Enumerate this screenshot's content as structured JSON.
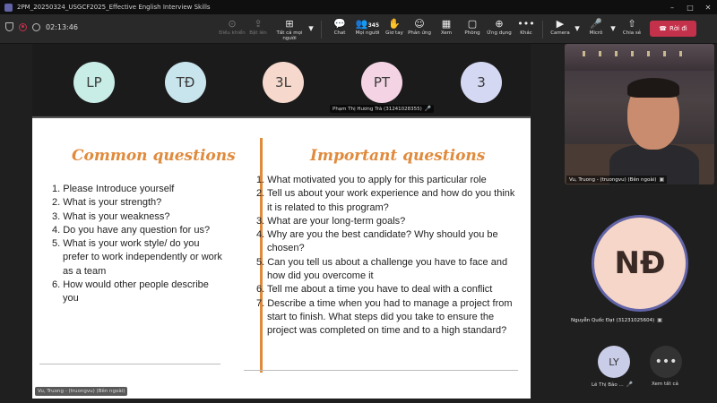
{
  "window": {
    "title": "2PM_20250324_USGCF2025_Effective English Interview Skills",
    "minimize": "–",
    "maximize": "□",
    "close": "✕"
  },
  "toolbar": {
    "timer": "02:13:46",
    "items": [
      {
        "label": "Điều khiển",
        "icon": "⊙"
      },
      {
        "label": "Bật lên",
        "icon": "⇪"
      },
      {
        "label": "Tất cả mọi người",
        "icon": "⊞"
      },
      {
        "label": "Chat",
        "icon": "💬"
      },
      {
        "label": "Mọi người",
        "icon": "👥",
        "count": "345"
      },
      {
        "label": "Giơ tay",
        "icon": "✋"
      },
      {
        "label": "Phản ứng",
        "icon": "☺"
      },
      {
        "label": "Xem",
        "icon": "▦"
      },
      {
        "label": "Phòng",
        "icon": "▢"
      },
      {
        "label": "Ứng dụng",
        "icon": "⊕"
      },
      {
        "label": "Khác",
        "icon": "•••"
      },
      {
        "label": "Camera",
        "icon": "▶"
      },
      {
        "label": "Micrô",
        "icon": "🎤"
      },
      {
        "label": "Chia sẻ",
        "icon": "⇧"
      }
    ],
    "leave_label": "Rời đi",
    "dropdown_arrow": "▾"
  },
  "strip": {
    "avatars": [
      {
        "initials": "LP",
        "color": "#c8ece6"
      },
      {
        "initials": "TĐ",
        "color": "#c8e4ec"
      },
      {
        "initials": "3L",
        "color": "#f6d8cc"
      },
      {
        "initials": "PT",
        "color": "#f4d4e4"
      },
      {
        "initials": "3",
        "color": "#d4d8f2"
      }
    ],
    "name_label": "Phạm Thị Hương Trà (31241028355)"
  },
  "slide": {
    "left_title": "Common questions",
    "left_items": [
      "1. Please Introduce yourself",
      "2. What is your strength?",
      "3. What is your weakness?",
      "4. Do you have any question for us?",
      "5. What is your work style/ do you prefer to work independently or work as a team",
      "6. How would other people describe you"
    ],
    "right_title": "Important questions",
    "right_items": [
      "1. What motivated you to apply for this particular role",
      "2. Tell us about your work experience and how do you think it is related to this program?",
      "3. What are your long-term goals?",
      "4. Why are you the best candidate? Why should you be chosen?",
      "5. Can you tell us about a challenge you have to face and how did you overcome it",
      "6. Tell me about a time you have to deal with a conflict",
      "7. Describe a time when you had to manage a project from start to finish. What steps did you take to ensure the project was completed on time and to a high standard?"
    ]
  },
  "presenter_caption": "Vu, Truong - (truongvu) (Bên ngoài)",
  "video_tile": {
    "name_label": "Vu, Truong - (truongvu) (Bên ngoài)"
  },
  "big_participant": {
    "initials": "NĐ",
    "name_label": "Nguyễn Quốc Đạt (31231025604)"
  },
  "small_participant": {
    "initials": "LY",
    "name_label": "Lê Thị Bảo ..."
  },
  "see_all": {
    "icon": "•••",
    "label": "Xem tất cả"
  }
}
